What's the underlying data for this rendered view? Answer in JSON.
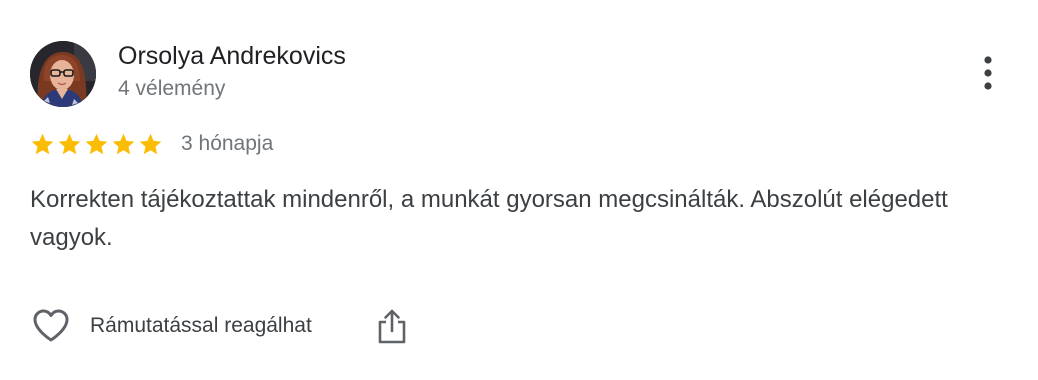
{
  "review": {
    "author_name": "Orsolya Andrekovics",
    "author_meta": "4 vélemény",
    "rating": 5,
    "rating_max": 5,
    "time_ago": "3 hónapja",
    "text": "Korrekten tájékoztattak mindenről, a munkát gyorsan megcsinálták. Abszolút elégedett vagyok.",
    "like_label": "Rámutatással reagálhat"
  },
  "icons": {
    "avatar": "profile-photo",
    "more": "more-vert-icon",
    "star": "star-icon",
    "like": "heart-outline-icon",
    "share": "share-icon"
  },
  "colors": {
    "star": "#fbbc04",
    "name": "#202124",
    "secondary": "#70757a",
    "body": "#3c4043",
    "icon": "#5f6368"
  }
}
